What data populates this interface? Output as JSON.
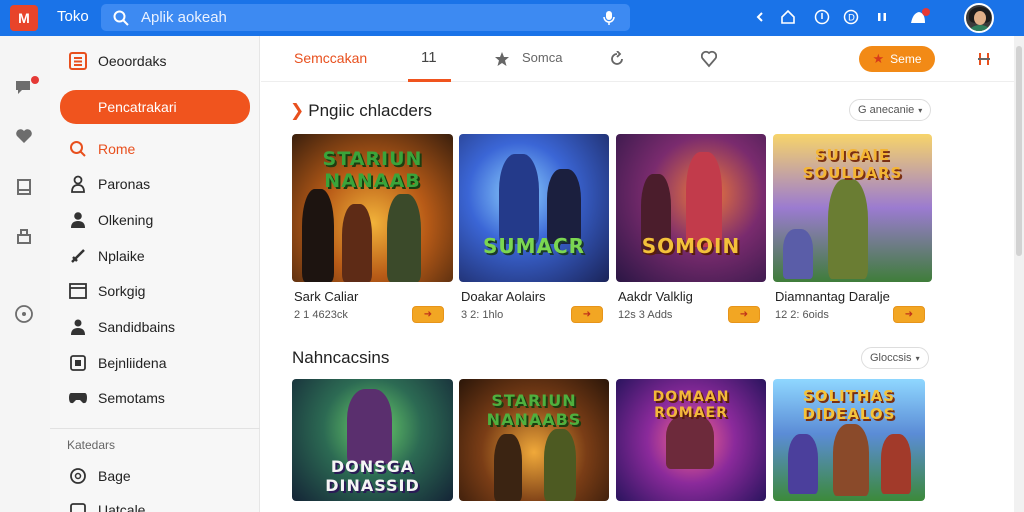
{
  "topbar": {
    "logo_text": "M",
    "app_title": "Toko",
    "search_placeholder": "Aplik aokeah",
    "icons": [
      "back-icon",
      "home-icon",
      "download-icon",
      "circle-d-icon",
      "pause-icon",
      "notification-bell-icon"
    ]
  },
  "rail": {
    "icons": [
      "chat-icon",
      "heart-icon",
      "book-icon",
      "store-icon",
      "compass-icon"
    ]
  },
  "sidebar": {
    "header_label": "Oeoordaks",
    "active_label": "Pencatrakari",
    "items": [
      {
        "icon": "search-icon",
        "label": "Rome"
      },
      {
        "icon": "person-icon",
        "label": "Paronas"
      },
      {
        "icon": "user-icon",
        "label": "Olkening"
      },
      {
        "icon": "sword-icon",
        "label": "Nplaike"
      },
      {
        "icon": "window-icon",
        "label": "Sorkgig"
      },
      {
        "icon": "users-icon",
        "label": "Sandidbains"
      },
      {
        "icon": "gamepad-icon",
        "label": "Bejnliidena"
      },
      {
        "icon": "controller-icon",
        "label": "Semotams"
      }
    ],
    "section_label": "Katedars",
    "section_items": [
      {
        "icon": "chat-bubble-icon",
        "label": "Bage"
      },
      {
        "icon": "tag-icon",
        "label": "Uatcale"
      }
    ]
  },
  "main": {
    "tabs": {
      "first": "Semccakan",
      "number": "11",
      "third": "Somca"
    },
    "game_button": "Seme",
    "section1": {
      "title": "Pngiic chlacders",
      "pill": "G anecanie"
    },
    "section2": {
      "title": "Nahncacsins",
      "pill": "Gloccsis"
    },
    "row1": [
      {
        "title": "Sark Caliar",
        "meta": "2 1 4623ck",
        "art_text": "STARIUN NANAAB"
      },
      {
        "title": "Doakar Aolairs",
        "meta": "3 2: 1hlo",
        "art_text": "SUMACR"
      },
      {
        "title": "Aakdr Valklig",
        "meta": "12s 3 Adds",
        "art_text": "SOMOIN"
      },
      {
        "title": "Diamnantag Daralje",
        "meta": "12 2: 6oids",
        "art_text": "SUIGAIE SOULDARS"
      }
    ],
    "row2": [
      {
        "art_text": "DONSGA DINASSID"
      },
      {
        "art_text": "STARIUN NANAABS"
      },
      {
        "art_text": "DOMAAN ROMAER"
      },
      {
        "art_text": "SOLITHAS DIDEALOS"
      }
    ]
  },
  "colors": {
    "topbar": "#1a73e8",
    "accent": "#f0541e",
    "badge": "#f2a623"
  }
}
